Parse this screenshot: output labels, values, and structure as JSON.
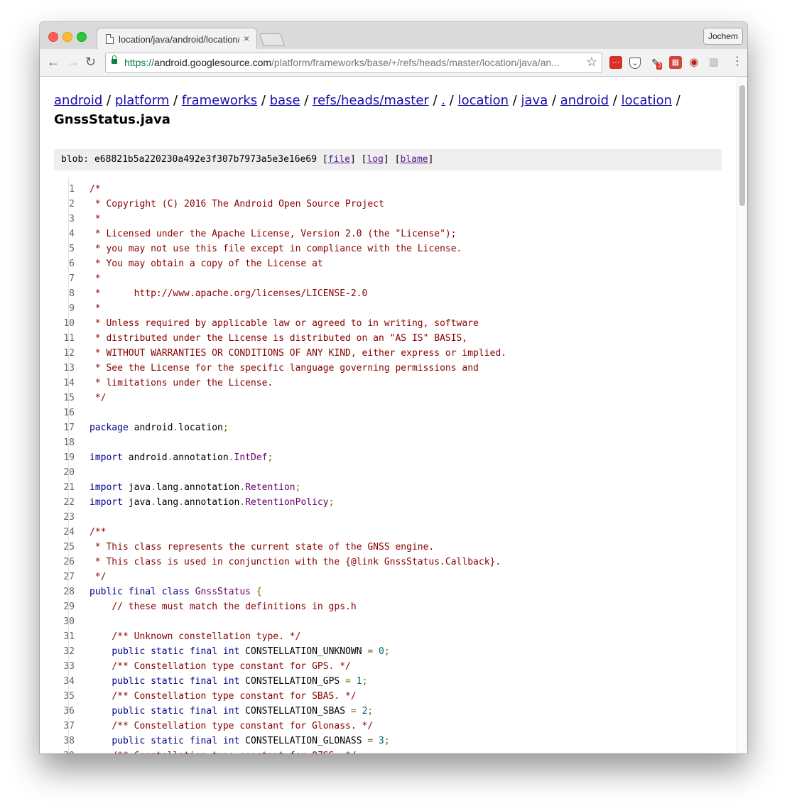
{
  "browser": {
    "tab_title": "location/java/android/location/",
    "tab_close": "×",
    "profile_name": "Jochem",
    "url_scheme": "https://",
    "url_host": "android.googlesource.com",
    "url_path": "/platform/frameworks/base/+/refs/heads/master/location/java/an...",
    "extension_badge": "3"
  },
  "breadcrumb": {
    "items": [
      "android",
      "platform",
      "frameworks",
      "base",
      "refs/heads/master",
      ".",
      "location",
      "java",
      "android",
      "location"
    ],
    "separator": "/",
    "filename": "GnssStatus.java"
  },
  "blob": {
    "label": "blob:",
    "hash": "e68821b5a220230a492e3f307b7973a5e3e16e69",
    "links": [
      "file",
      "log",
      "blame"
    ]
  },
  "code_lines": [
    [
      [
        "c",
        "/*"
      ]
    ],
    [
      [
        "c",
        " * Copyright (C) 2016 The Android Open Source Project"
      ]
    ],
    [
      [
        "c",
        " *"
      ]
    ],
    [
      [
        "c",
        " * Licensed under the Apache License, Version 2.0 (the \"License\");"
      ]
    ],
    [
      [
        "c",
        " * you may not use this file except in compliance with the License."
      ]
    ],
    [
      [
        "c",
        " * You may obtain a copy of the License at"
      ]
    ],
    [
      [
        "c",
        " *"
      ]
    ],
    [
      [
        "c",
        " *      http://www.apache.org/licenses/LICENSE-2.0"
      ]
    ],
    [
      [
        "c",
        " *"
      ]
    ],
    [
      [
        "c",
        " * Unless required by applicable law or agreed to in writing, software"
      ]
    ],
    [
      [
        "c",
        " * distributed under the License is distributed on an \"AS IS\" BASIS,"
      ]
    ],
    [
      [
        "c",
        " * WITHOUT WARRANTIES OR CONDITIONS OF ANY KIND, either express or implied."
      ]
    ],
    [
      [
        "c",
        " * See the License for the specific language governing permissions and"
      ]
    ],
    [
      [
        "c",
        " * limitations under the License."
      ]
    ],
    [
      [
        "c",
        " */"
      ]
    ],
    [],
    [
      [
        "k",
        "package"
      ],
      [
        "",
        " android"
      ],
      [
        "p",
        "."
      ],
      [
        "",
        "location"
      ],
      [
        "p",
        ";"
      ]
    ],
    [],
    [
      [
        "k",
        "import"
      ],
      [
        "",
        " android"
      ],
      [
        "p",
        "."
      ],
      [
        "",
        "annotation"
      ],
      [
        "p",
        "."
      ],
      [
        "t",
        "IntDef"
      ],
      [
        "p",
        ";"
      ]
    ],
    [],
    [
      [
        "k",
        "import"
      ],
      [
        "",
        " java"
      ],
      [
        "p",
        "."
      ],
      [
        "",
        "lang"
      ],
      [
        "p",
        "."
      ],
      [
        "",
        "annotation"
      ],
      [
        "p",
        "."
      ],
      [
        "t",
        "Retention"
      ],
      [
        "p",
        ";"
      ]
    ],
    [
      [
        "k",
        "import"
      ],
      [
        "",
        " java"
      ],
      [
        "p",
        "."
      ],
      [
        "",
        "lang"
      ],
      [
        "p",
        "."
      ],
      [
        "",
        "annotation"
      ],
      [
        "p",
        "."
      ],
      [
        "t",
        "RetentionPolicy"
      ],
      [
        "p",
        ";"
      ]
    ],
    [],
    [
      [
        "c",
        "/**"
      ]
    ],
    [
      [
        "c",
        " * This class represents the current state of the GNSS engine."
      ]
    ],
    [
      [
        "c",
        " * This class is used in conjunction with the {@link GnssStatus.Callback}."
      ]
    ],
    [
      [
        "c",
        " */"
      ]
    ],
    [
      [
        "k",
        "public"
      ],
      [
        "",
        " "
      ],
      [
        "k",
        "final"
      ],
      [
        "",
        " "
      ],
      [
        "k",
        "class"
      ],
      [
        "",
        " "
      ],
      [
        "t",
        "GnssStatus"
      ],
      [
        "",
        " "
      ],
      [
        "p",
        "{"
      ]
    ],
    [
      [
        "",
        "    "
      ],
      [
        "c",
        "// these must match the definitions in gps.h"
      ]
    ],
    [],
    [
      [
        "",
        "    "
      ],
      [
        "c",
        "/** Unknown constellation type. */"
      ]
    ],
    [
      [
        "",
        "    "
      ],
      [
        "k",
        "public"
      ],
      [
        "",
        " "
      ],
      [
        "k",
        "static"
      ],
      [
        "",
        " "
      ],
      [
        "k",
        "final"
      ],
      [
        "",
        " "
      ],
      [
        "k",
        "int"
      ],
      [
        "",
        " CONSTELLATION_UNKNOWN "
      ],
      [
        "p",
        "="
      ],
      [
        "",
        " "
      ],
      [
        "n",
        "0"
      ],
      [
        "p",
        ";"
      ]
    ],
    [
      [
        "",
        "    "
      ],
      [
        "c",
        "/** Constellation type constant for GPS. */"
      ]
    ],
    [
      [
        "",
        "    "
      ],
      [
        "k",
        "public"
      ],
      [
        "",
        " "
      ],
      [
        "k",
        "static"
      ],
      [
        "",
        " "
      ],
      [
        "k",
        "final"
      ],
      [
        "",
        " "
      ],
      [
        "k",
        "int"
      ],
      [
        "",
        " CONSTELLATION_GPS "
      ],
      [
        "p",
        "="
      ],
      [
        "",
        " "
      ],
      [
        "n",
        "1"
      ],
      [
        "p",
        ";"
      ]
    ],
    [
      [
        "",
        "    "
      ],
      [
        "c",
        "/** Constellation type constant for SBAS. */"
      ]
    ],
    [
      [
        "",
        "    "
      ],
      [
        "k",
        "public"
      ],
      [
        "",
        " "
      ],
      [
        "k",
        "static"
      ],
      [
        "",
        " "
      ],
      [
        "k",
        "final"
      ],
      [
        "",
        " "
      ],
      [
        "k",
        "int"
      ],
      [
        "",
        " CONSTELLATION_SBAS "
      ],
      [
        "p",
        "="
      ],
      [
        "",
        " "
      ],
      [
        "n",
        "2"
      ],
      [
        "p",
        ";"
      ]
    ],
    [
      [
        "",
        "    "
      ],
      [
        "c",
        "/** Constellation type constant for Glonass. */"
      ]
    ],
    [
      [
        "",
        "    "
      ],
      [
        "k",
        "public"
      ],
      [
        "",
        " "
      ],
      [
        "k",
        "static"
      ],
      [
        "",
        " "
      ],
      [
        "k",
        "final"
      ],
      [
        "",
        " "
      ],
      [
        "k",
        "int"
      ],
      [
        "",
        " CONSTELLATION_GLONASS "
      ],
      [
        "p",
        "="
      ],
      [
        "",
        " "
      ],
      [
        "n",
        "3"
      ],
      [
        "p",
        ";"
      ]
    ],
    [
      [
        "",
        "    "
      ],
      [
        "c",
        "/** Constellation type constant for QZSS. */"
      ]
    ]
  ]
}
